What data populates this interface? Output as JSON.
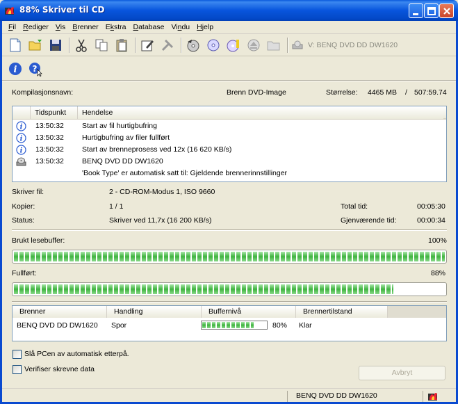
{
  "window": {
    "title": "88% Skriver til CD"
  },
  "menu": [
    {
      "label": "Fil",
      "key": "F"
    },
    {
      "label": "Rediger",
      "key": "R"
    },
    {
      "label": "Vis",
      "key": "V"
    },
    {
      "label": "Brenner",
      "key": "B"
    },
    {
      "label": "Ekstra",
      "key": "k"
    },
    {
      "label": "Database",
      "key": "D"
    },
    {
      "label": "Vindu",
      "key": "n"
    },
    {
      "label": "Hjelp",
      "key": "H"
    }
  ],
  "toolbar": {
    "drive_label": "V: BENQ      DVD DD DW1620"
  },
  "compilation": {
    "label": "Kompilasjonsnavn:",
    "value": "Brenn DVD-Image",
    "size_label": "Størrelse:",
    "size_mb": "4465 MB",
    "size_sep": "/",
    "size_time": "507:59.74"
  },
  "log": {
    "col_time": "Tidspunkt",
    "col_event": "Hendelse",
    "rows": [
      {
        "icon": "info-icon",
        "time": "13:50:32",
        "event": "Start av fil hurtigbufring"
      },
      {
        "icon": "info-icon",
        "time": "13:50:32",
        "event": "Hurtigbufring av filer fullført"
      },
      {
        "icon": "info-icon",
        "time": "13:50:32",
        "event": "Start av brenneprosess ved 12x (16 620 KB/s)"
      },
      {
        "icon": "drive-icon",
        "time": "13:50:32",
        "event": "BENQ      DVD DD DW1620"
      },
      {
        "icon": "",
        "time": "",
        "event": "'Book Type' er automatisk satt til: Gjeldende brennerinnstillinger"
      }
    ]
  },
  "details": {
    "writing_file_label": "Skriver fil:",
    "writing_file": "2 - CD-ROM-Modus 1, ISO 9660",
    "copies_label": "Kopier:",
    "copies": "1 / 1",
    "total_time_label": "Total tid:",
    "total_time": "00:05:30",
    "status_label": "Status:",
    "status": "Skriver ved 11,7x (16 200 KB/s)",
    "remaining_label": "Gjenværende tid:",
    "remaining": "00:00:34"
  },
  "buffer": {
    "label": "Brukt lesebuffer:",
    "percent_text": "100%",
    "fraction": 1.0
  },
  "progress": {
    "label": "Fullført:",
    "percent_text": "88%",
    "fraction": 0.88
  },
  "burner_table": {
    "col_burner": "Brenner",
    "col_action": "Handling",
    "col_buffer": "Buffernivå",
    "col_state": "Brennertilstand",
    "rows": [
      {
        "burner": "BENQ DVD DD DW1620",
        "action": "Spor",
        "buffer_text": "80%",
        "buffer_fraction": 0.8,
        "state": "Klar"
      }
    ]
  },
  "options": {
    "shutdown_label": "Slå PCen av automatisk etterpå.",
    "verify_label": "Verifiser skrevne data"
  },
  "abort_label": "Avbryt",
  "statusbar": {
    "drive": "BENQ      DVD DD DW1620"
  }
}
